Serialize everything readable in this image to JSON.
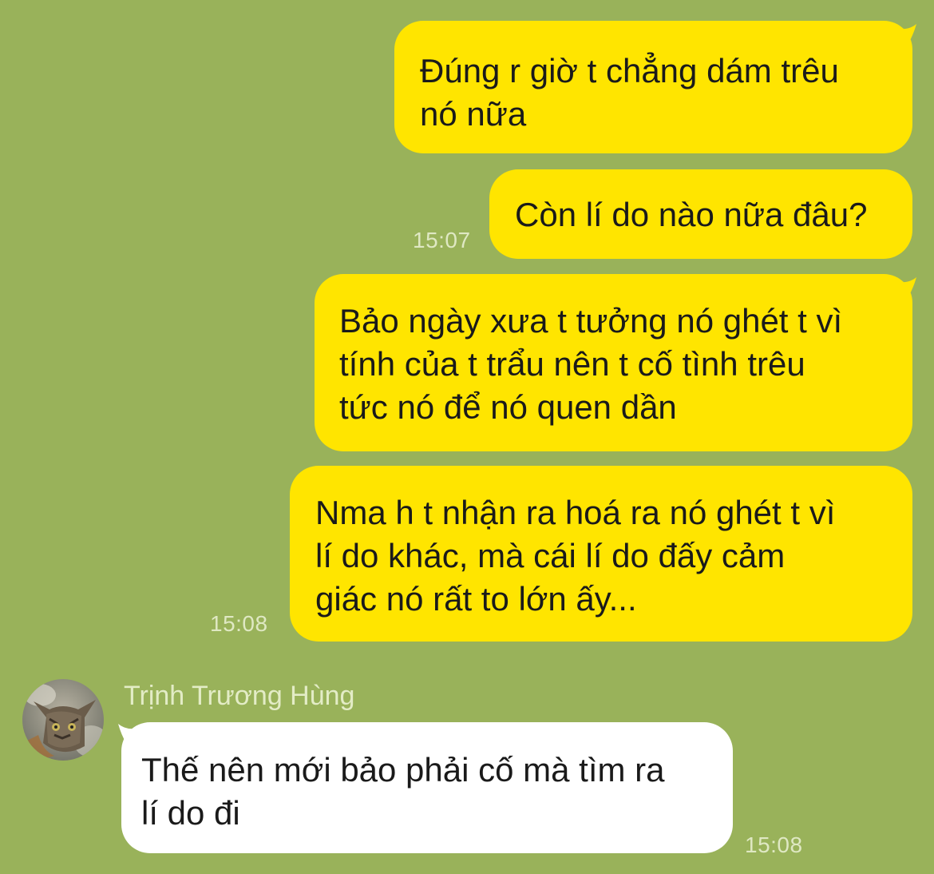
{
  "messages": [
    {
      "text": "Đúng r giờ t chẳng dám trêu\nnó nữa",
      "side": "outgoing",
      "time": ""
    },
    {
      "text": "Còn lí do nào nữa đâu?",
      "side": "outgoing",
      "time": "15:07"
    },
    {
      "text": "Bảo ngày xưa t tưởng nó ghét t vì\ntính của t trẩu nên t cố tình trêu\ntức nó để nó quen dần",
      "side": "outgoing",
      "time": ""
    },
    {
      "text": "Nma h t nhận ra hoá ra nó ghét t vì\nlí do khác, mà cái lí do đấy cảm\ngiác nó rất to lớn ấy...",
      "side": "outgoing",
      "time": "15:08"
    },
    {
      "text": "Thế nên mới bảo phải cố mà tìm ra\nlí do đi",
      "side": "incoming",
      "time": "15:08",
      "sender": "Trịnh Trương Hùng"
    }
  ],
  "colors": {
    "background": "#99b25a",
    "outgoing_bubble": "#ffe500",
    "incoming_bubble": "#ffffff",
    "timestamp": "#dfe8c3"
  },
  "avatar_icon": "cat-avatar-icon"
}
